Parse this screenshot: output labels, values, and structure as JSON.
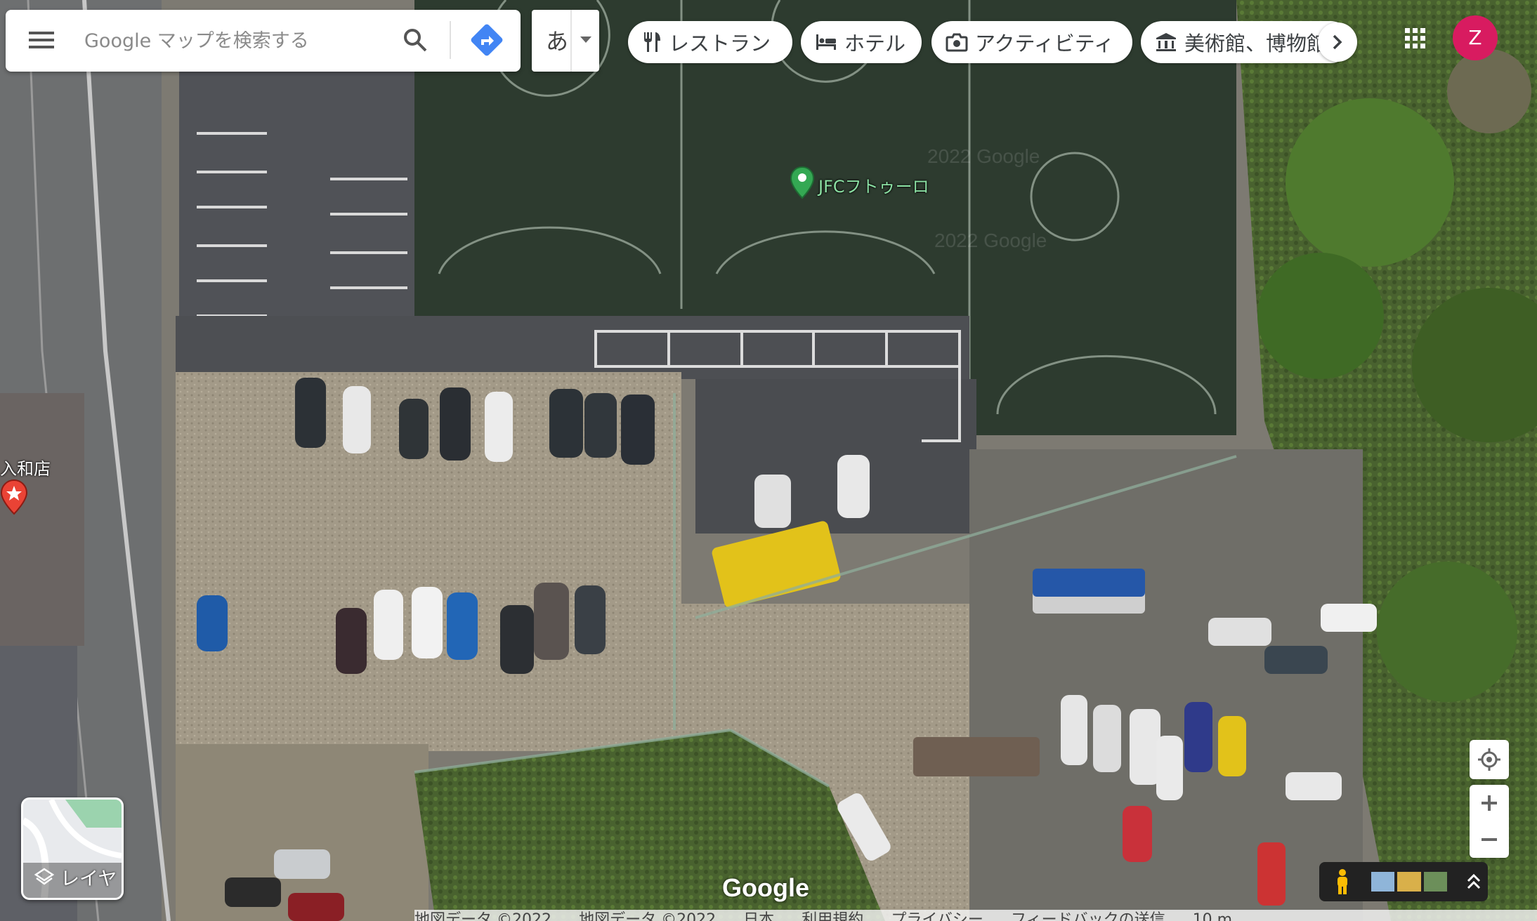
{
  "search": {
    "placeholder": "Google マップを検索する"
  },
  "input_method": {
    "label": "あ"
  },
  "category_chips": [
    {
      "label": "レストラン",
      "icon": "restaurant-icon"
    },
    {
      "label": "ホテル",
      "icon": "hotel-icon"
    },
    {
      "label": "アクティビティ",
      "icon": "camera-icon"
    },
    {
      "label": "美術館、博物館",
      "icon": "museum-icon"
    }
  ],
  "account": {
    "initial": "Z",
    "color": "#d81b60"
  },
  "map": {
    "view": "satellite",
    "place_label": "JFCフトゥーロ",
    "store_label": "入和店",
    "watermarks": [
      "2022 Google",
      "2022 Google"
    ]
  },
  "layers": {
    "label": "レイヤ"
  },
  "branding": {
    "logo": "Google"
  },
  "footer": {
    "items": [
      "地図データ ©2022",
      "地図データ ©2022",
      "日本",
      "利用規約",
      "プライバシー",
      "フィードバックの送信",
      "10 m"
    ]
  },
  "colors": {
    "accent_blue": "#4285f4",
    "place_pin": "#34a853",
    "avatar": "#d81b60",
    "store_pin": "#ea4335"
  }
}
